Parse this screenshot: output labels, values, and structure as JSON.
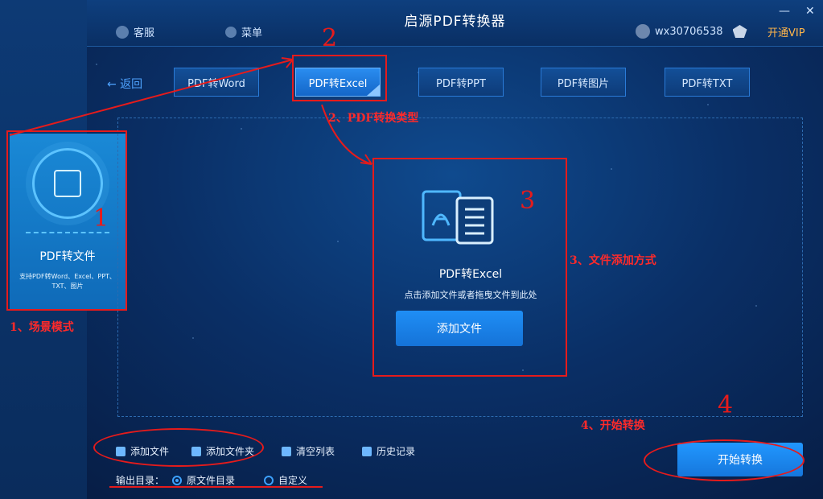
{
  "app": {
    "title": "启源PDF转换器",
    "minimize": "—",
    "close": "✕"
  },
  "toolbar": {
    "service": "客服",
    "menu": "菜单",
    "username": "wx30706538",
    "vip": "开通VIP"
  },
  "nav": {
    "back": "← 返回"
  },
  "tabs": [
    {
      "label": "PDF转Word",
      "active": false
    },
    {
      "label": "PDF转Excel",
      "active": true
    },
    {
      "label": "PDF转PPT",
      "active": false
    },
    {
      "label": "PDF转图片",
      "active": false
    },
    {
      "label": "PDF转TXT",
      "active": false
    }
  ],
  "scene": {
    "title": "PDF转文件",
    "desc": "支持PDF转Word、Excel、PPT、TXT、图片"
  },
  "drop": {
    "title": "PDF转Excel",
    "hint": "点击添加文件或者拖曳文件到此处",
    "add_button": "添加文件"
  },
  "bottom": {
    "add_file": "添加文件",
    "add_folder": "添加文件夹",
    "clear_list": "清空列表",
    "history": "历史记录",
    "output_label": "输出目录：",
    "radio_original": "原文件目录",
    "radio_custom": "自定义",
    "start_button": "开始转换"
  },
  "annotations": {
    "a1": "1、场景模式",
    "a2": "2、PDF转换类型",
    "a3": "3、文件添加方式",
    "a4": "4、开始转换",
    "n1": "1",
    "n2": "2",
    "n3": "3",
    "n4": "4"
  },
  "colors": {
    "accent": "#1f8ef5",
    "vip": "#ffb54a",
    "annotation": "#e61b1b"
  }
}
